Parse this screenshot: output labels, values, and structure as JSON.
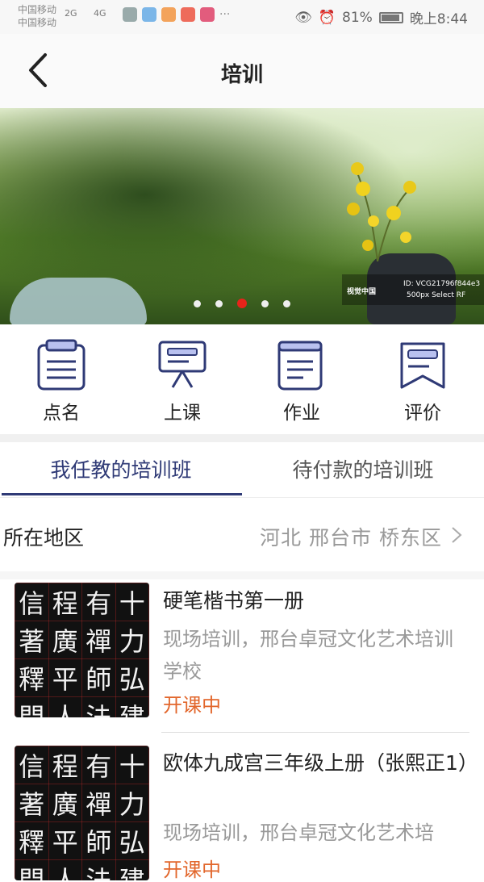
{
  "status_bar": {
    "carrier1": "中国移动",
    "carrier2": "中国移动",
    "net1": "2G",
    "net2": "4G",
    "more": "···",
    "battery": "81%",
    "time": "晚上8:44"
  },
  "nav": {
    "title": "培训"
  },
  "banner": {
    "watermark_brand": "视觉中国",
    "watermark_id": "ID: VCG21796f844e3",
    "watermark_sub": "500px Select RF",
    "slide_count": 5,
    "active_slide": 3
  },
  "actions": [
    {
      "label": "点名",
      "icon": "clipboard-list-icon"
    },
    {
      "label": "上课",
      "icon": "presentation-board-icon"
    },
    {
      "label": "作业",
      "icon": "document-icon"
    },
    {
      "label": "评价",
      "icon": "bookmark-icon"
    }
  ],
  "tabs": [
    {
      "label": "我任教的培训班",
      "active": true
    },
    {
      "label": "待付款的培训班",
      "active": false
    }
  ],
  "region": {
    "label": "所在地区",
    "value": "河北 邢台市 桥东区"
  },
  "thumb_chars": [
    "信",
    "程",
    "有",
    "十",
    "著",
    "廣",
    "禪",
    "力",
    "釋",
    "平",
    "師",
    "弘",
    "門",
    "人",
    "法",
    "建"
  ],
  "courses": [
    {
      "title": "硬笔楷书第一册",
      "desc": "现场培训，邢台卓冠文化艺术培训学校",
      "status": "开课中"
    },
    {
      "title": "欧体九成宫三年级上册（张熙正1）",
      "desc": "现场培训，邢台卓冠文化艺术培",
      "status": "开课中"
    }
  ],
  "colors": {
    "accent": "#2f3a76",
    "status_orange": "#e2662b",
    "active_dot": "#e8231a"
  }
}
